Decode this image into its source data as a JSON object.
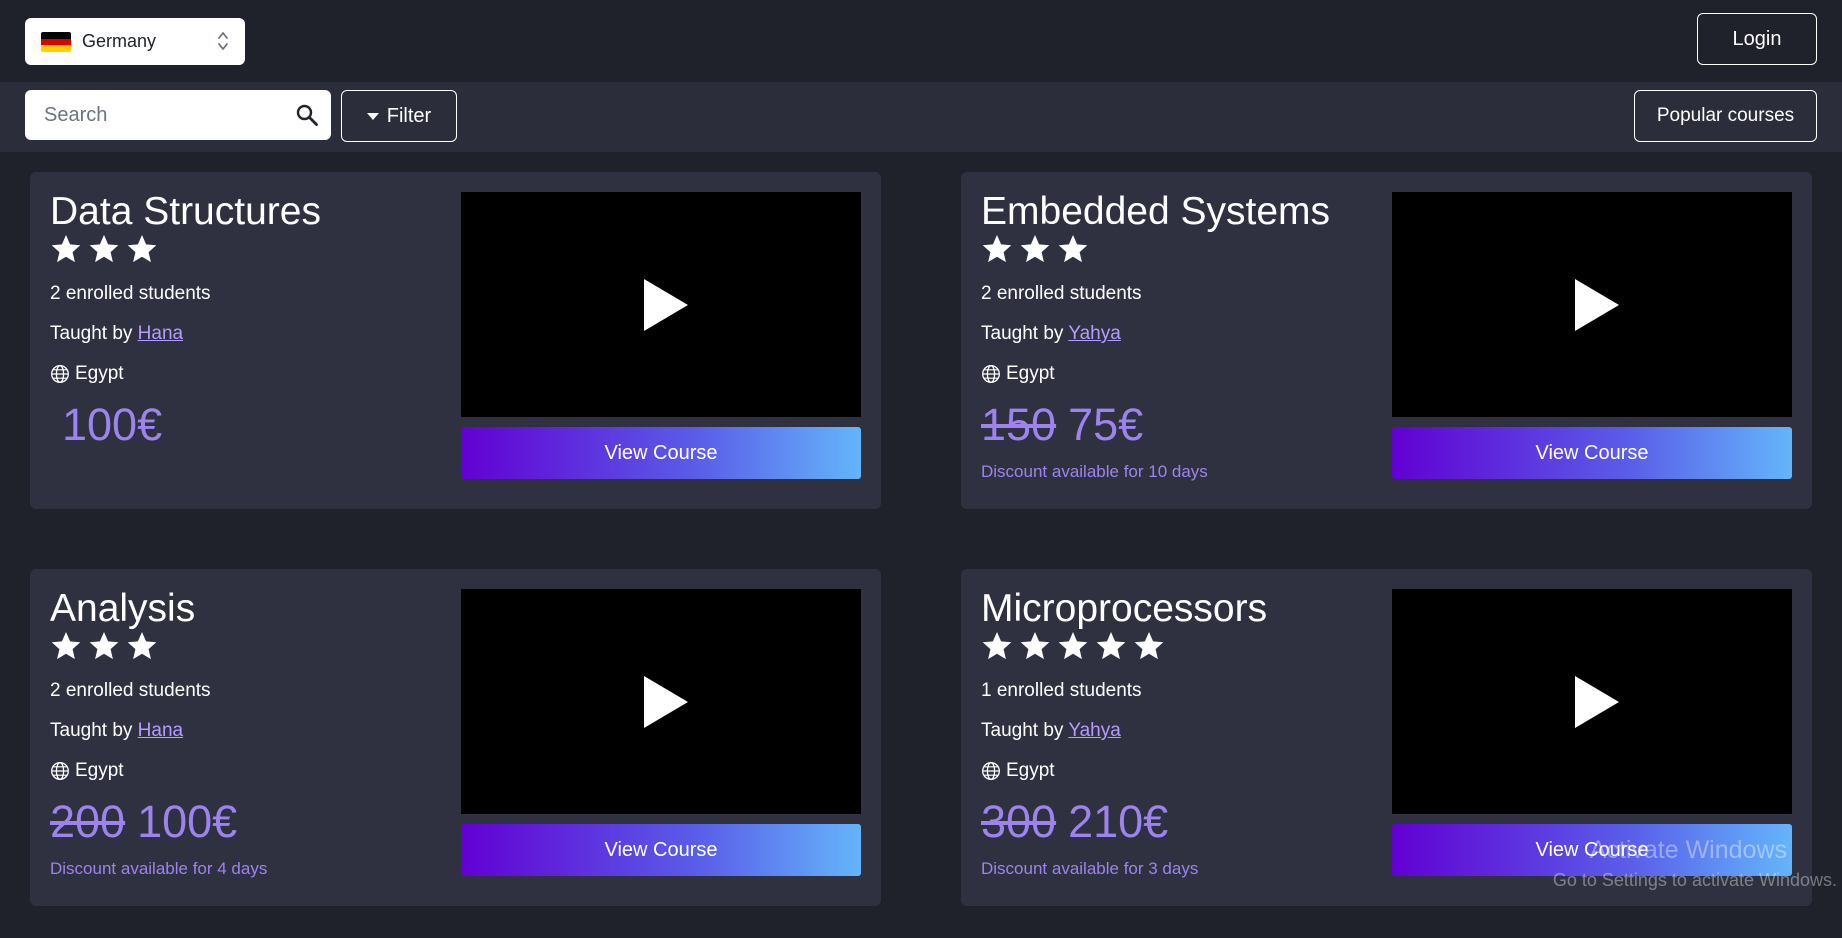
{
  "header": {
    "country": "Germany",
    "login_label": "Login"
  },
  "toolbar": {
    "search_placeholder": "Search",
    "filter_label": "Filter",
    "popular_label": "Popular courses"
  },
  "courses": [
    {
      "title": "Data Structures",
      "rating": 3,
      "enrolled": "2 enrolled students",
      "taught_prefix": "Taught by ",
      "teacher": "Hana",
      "location": "Egypt",
      "old_price": "",
      "price": "100€",
      "discount": "",
      "view_label": "View Course"
    },
    {
      "title": "Embedded Systems",
      "rating": 3,
      "enrolled": "2 enrolled students",
      "taught_prefix": "Taught by ",
      "teacher": "Yahya",
      "location": "Egypt",
      "old_price": "150",
      "price": "75€",
      "discount": "Discount available for 10 days",
      "view_label": "View Course"
    },
    {
      "title": "Analysis",
      "rating": 3,
      "enrolled": "2 enrolled students",
      "taught_prefix": "Taught by ",
      "teacher": "Hana",
      "location": "Egypt",
      "old_price": "200",
      "price": "100€",
      "discount": "Discount available for 4 days",
      "view_label": "View Course"
    },
    {
      "title": "Microprocessors",
      "rating": 5,
      "enrolled": "1 enrolled students",
      "taught_prefix": "Taught by ",
      "teacher": "Yahya",
      "location": "Egypt",
      "old_price": "300",
      "price": "210€",
      "discount": "Discount available for 3 days",
      "view_label": "View Course"
    }
  ],
  "watermark": {
    "line1": "Activate Windows",
    "line2": "Go to Settings to activate Windows."
  },
  "colors": {
    "background": "#1f212b",
    "toolbar": "#2b2d3a",
    "card": "#2f3140",
    "price": "#9c83ee",
    "link": "#b59cff",
    "button_gradient_start": "#6200d3",
    "button_gradient_end": "#64b5fa"
  },
  "icons": {
    "search": "search-icon",
    "filter_caret": "caret-down-icon",
    "star": "star-icon",
    "globe": "globe-icon",
    "play": "play-icon",
    "flag": "germany-flag-icon"
  }
}
